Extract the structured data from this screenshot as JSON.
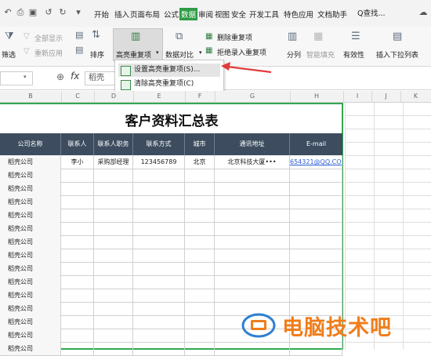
{
  "quick_access": [
    "undo-icon",
    "print-icon",
    "preview-icon",
    "undo-arrow-icon",
    "redo-arrow-icon",
    "customize-icon"
  ],
  "menu": [
    "开始",
    "插入",
    "页面布局",
    "公式",
    "数据",
    "审阅",
    "视图",
    "安全",
    "开发工具",
    "特色应用",
    "文档助手"
  ],
  "active_menu": "数据",
  "search_label": "Q查找...",
  "ribbon": {
    "show_all": "全部显示",
    "reapply": "重新应用",
    "filter": "筛选",
    "sort": "排序",
    "highlight_dup": "高亮重复项",
    "data_compare": "数据对比",
    "delete_dup": "删除重复项",
    "reject_dup": "拒绝录入重复项",
    "split": "分列",
    "smart_fill": "智能填充",
    "validity": "有效性",
    "insert_dropdown": "插入下拉列表"
  },
  "dropdown": {
    "items": [
      "设置高亮重复项(S)...",
      "清除高亮重复项(C)"
    ]
  },
  "formula_bar": {
    "fx": "fx",
    "value": "稻壳"
  },
  "columns": [
    "B",
    "C",
    "D",
    "E",
    "F",
    "G",
    "H",
    "I",
    "J",
    "K"
  ],
  "sheet": {
    "title": "客户资料汇总表",
    "headers": [
      "公司名称",
      "联系人",
      "联系人职务",
      "联系方式",
      "城市",
      "通讯地址",
      "E-mail"
    ],
    "first_row": [
      "稻壳公司",
      "李小",
      "采购部经理",
      "123456789",
      "北京",
      "北京科技大厦•••",
      "654321@QQ.COM"
    ],
    "repeat_company": "稻壳公司",
    "repeat_rows": 14
  },
  "watermark": "电脑技术吧",
  "colors": {
    "accent": "#2f9b45",
    "header_bg": "#3d4d5f",
    "arrow": "#e23b3b",
    "watermark": "#f07d1a"
  }
}
